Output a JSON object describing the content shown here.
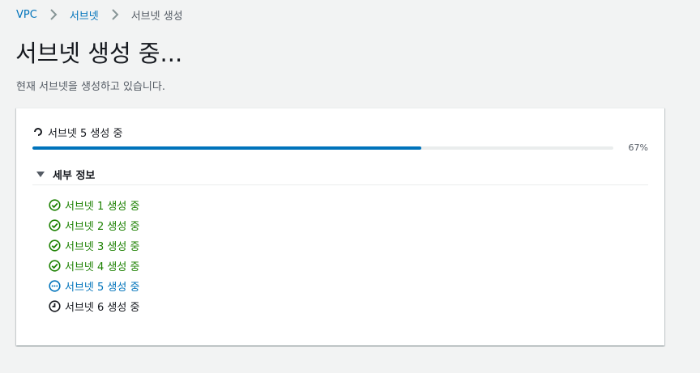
{
  "breadcrumb": {
    "items": [
      {
        "label": "VPC",
        "link": true
      },
      {
        "label": "서브넷",
        "link": true
      },
      {
        "label": "서브넷 생성",
        "link": false
      }
    ],
    "separator_icon": "chevron-right-icon"
  },
  "page": {
    "title": "서브넷 생성 중...",
    "description": "현재 서브넷을 생성하고 있습니다."
  },
  "progress": {
    "status_icon": "spinner-icon",
    "status_text": "서브넷 5 생성 중",
    "percent": 67,
    "percent_label": "67%",
    "color": "#0073bb"
  },
  "details": {
    "title": "세부 정보",
    "expanded": true,
    "steps": [
      {
        "label": "서브넷 1 생성 중",
        "status": "success",
        "icon": "check-circle-icon"
      },
      {
        "label": "서브넷 2 생성 중",
        "status": "success",
        "icon": "check-circle-icon"
      },
      {
        "label": "서브넷 3 생성 중",
        "status": "success",
        "icon": "check-circle-icon"
      },
      {
        "label": "서브넷 4 생성 중",
        "status": "success",
        "icon": "check-circle-icon"
      },
      {
        "label": "서브넷 5 생성 중",
        "status": "in-progress",
        "icon": "ellipsis-circle-icon"
      },
      {
        "label": "서브넷 6 생성 중",
        "status": "pending",
        "icon": "clock-icon"
      }
    ]
  },
  "colors": {
    "link": "#0073bb",
    "success": "#1d8102",
    "text": "#16191f",
    "muted": "#545b64",
    "background": "#f2f3f3"
  }
}
